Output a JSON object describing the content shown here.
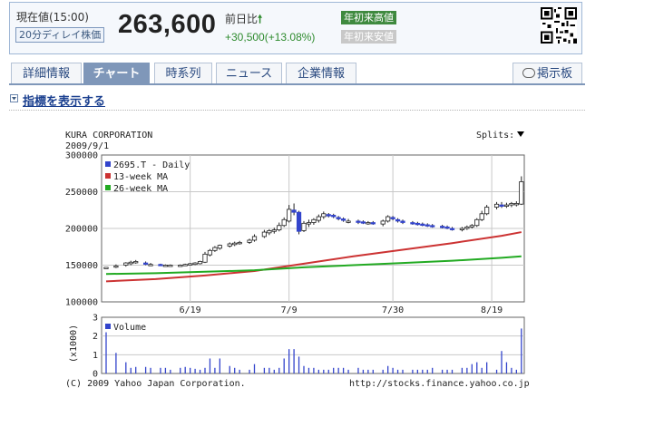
{
  "quote": {
    "price_label": "現在値(15:00)",
    "delay_label": "20分ディレイ株価",
    "price": "263,600",
    "change_label": "前日比",
    "change_value": "+30,500(+13.08%)",
    "ytd_high_label": "年初来高値",
    "ytd_low_label": "年初来安値"
  },
  "tabs": [
    {
      "label": "詳細情報",
      "active": false
    },
    {
      "label": "チャート",
      "active": true
    },
    {
      "label": "時系列",
      "active": false
    },
    {
      "label": "ニュース",
      "active": false
    },
    {
      "label": "企業情報",
      "active": false
    }
  ],
  "board_label": "掲示板",
  "indicator_toggle": "指標を表示する",
  "chart_header": {
    "company": "KURA CORPORATION",
    "date": "2009/9/1",
    "splits_label": "Splits:"
  },
  "footer": {
    "copyright": "(C) 2009 Yahoo Japan Corporation.",
    "url": "http://stocks.finance.yahoo.co.jp"
  },
  "chart_data": [
    {
      "type": "candlestick",
      "ylim": [
        100000,
        300000
      ],
      "y_ticks": [
        "300000",
        "250000",
        "200000",
        "150000",
        "100000"
      ],
      "x_ticks": [
        {
          "label": "6/19",
          "day": 17
        },
        {
          "label": "7/9",
          "day": 37
        },
        {
          "label": "7/30",
          "day": 58
        },
        {
          "label": "8/19",
          "day": 78
        }
      ],
      "legend": [
        {
          "name": "2695.T - Daily",
          "color": "#3344cc"
        },
        {
          "name": "13-week MA",
          "color": "#cc3333"
        },
        {
          "name": "26-week MA",
          "color": "#22aa22"
        }
      ],
      "candles": [
        [
          0,
          147000,
          147000,
          145000,
          147000
        ],
        [
          2,
          148000,
          151000,
          146000,
          149000
        ],
        [
          4,
          150000,
          154000,
          148000,
          153000
        ],
        [
          5,
          152000,
          156000,
          150000,
          154000
        ],
        [
          6,
          154000,
          157000,
          152000,
          155000
        ],
        [
          8,
          153000,
          155000,
          150000,
          152000
        ],
        [
          9,
          151000,
          153000,
          149000,
          151000
        ],
        [
          11,
          151000,
          152000,
          149000,
          150000
        ],
        [
          12,
          150000,
          151000,
          148000,
          150000
        ],
        [
          13,
          150000,
          151000,
          149000,
          150000
        ],
        [
          15,
          150000,
          151000,
          149000,
          150000
        ],
        [
          16,
          150000,
          152000,
          149000,
          151000
        ],
        [
          17,
          151000,
          153000,
          150000,
          152000
        ],
        [
          18,
          151000,
          154000,
          150000,
          153000
        ],
        [
          19,
          152000,
          156000,
          151000,
          155000
        ],
        [
          20,
          154000,
          168000,
          153000,
          165000
        ],
        [
          21,
          164000,
          172000,
          162000,
          170000
        ],
        [
          22,
          170000,
          176000,
          168000,
          174000
        ],
        [
          23,
          173000,
          178000,
          171000,
          177000
        ],
        [
          25,
          176000,
          181000,
          174000,
          179000
        ],
        [
          26,
          178000,
          182000,
          176000,
          180000
        ],
        [
          27,
          180000,
          183000,
          178000,
          181000
        ],
        [
          29,
          181000,
          186000,
          179000,
          184000
        ],
        [
          30,
          184000,
          192000,
          182000,
          189000
        ],
        [
          32,
          189000,
          198000,
          187000,
          195000
        ],
        [
          33,
          194000,
          199000,
          191000,
          197000
        ],
        [
          34,
          196000,
          201000,
          193000,
          198000
        ],
        [
          35,
          198000,
          208000,
          196000,
          204000
        ],
        [
          36,
          204000,
          215000,
          202000,
          212000
        ],
        [
          37,
          210000,
          232000,
          208000,
          226000
        ],
        [
          38,
          225000,
          234000,
          218000,
          222000
        ],
        [
          39,
          222000,
          224000,
          192000,
          196000
        ],
        [
          40,
          197000,
          210000,
          195000,
          207000
        ],
        [
          41,
          206000,
          212000,
          202000,
          208000
        ],
        [
          42,
          208000,
          214000,
          205000,
          212000
        ],
        [
          43,
          211000,
          219000,
          208000,
          216000
        ],
        [
          44,
          216000,
          223000,
          213000,
          220000
        ],
        [
          45,
          219000,
          221000,
          215000,
          217000
        ],
        [
          46,
          218000,
          220000,
          214000,
          216000
        ],
        [
          47,
          215000,
          217000,
          211000,
          213000
        ],
        [
          48,
          213000,
          215000,
          209000,
          211000
        ],
        [
          49,
          210000,
          213000,
          207000,
          210000
        ],
        [
          51,
          210000,
          212000,
          206000,
          209000
        ],
        [
          52,
          209000,
          211000,
          206000,
          208000
        ],
        [
          53,
          208000,
          210000,
          205000,
          208000
        ],
        [
          54,
          208000,
          210000,
          205000,
          207000
        ],
        [
          56,
          206000,
          212000,
          203000,
          210000
        ],
        [
          57,
          210000,
          218000,
          208000,
          216000
        ],
        [
          58,
          215000,
          217000,
          211000,
          213000
        ],
        [
          59,
          212000,
          214000,
          208000,
          210000
        ],
        [
          60,
          210000,
          212000,
          206000,
          208000
        ],
        [
          62,
          208000,
          210000,
          205000,
          207000
        ],
        [
          63,
          207000,
          209000,
          204000,
          206000
        ],
        [
          64,
          206000,
          208000,
          203000,
          205000
        ],
        [
          65,
          205000,
          207000,
          202000,
          204000
        ],
        [
          66,
          204000,
          206000,
          201000,
          203000
        ],
        [
          68,
          203000,
          205000,
          200000,
          202000
        ],
        [
          69,
          202000,
          204000,
          199000,
          201000
        ],
        [
          70,
          200000,
          202000,
          197000,
          199000
        ],
        [
          72,
          199000,
          202000,
          196000,
          200000
        ],
        [
          73,
          200000,
          204000,
          198000,
          202000
        ],
        [
          74,
          202000,
          206000,
          200000,
          204000
        ],
        [
          75,
          204000,
          214000,
          202000,
          212000
        ],
        [
          76,
          212000,
          224000,
          210000,
          220000
        ],
        [
          77,
          220000,
          232000,
          218000,
          229000
        ],
        [
          79,
          229000,
          236000,
          226000,
          233000
        ],
        [
          80,
          232000,
          236000,
          228000,
          231000
        ],
        [
          81,
          231000,
          235000,
          228000,
          232000
        ],
        [
          82,
          232000,
          236000,
          229000,
          234000
        ],
        [
          83,
          233000,
          237000,
          230000,
          234000
        ],
        [
          84,
          233100,
          271000,
          232000,
          263600
        ]
      ],
      "ma13": [
        [
          0,
          128000
        ],
        [
          10,
          131000
        ],
        [
          20,
          136000
        ],
        [
          30,
          142000
        ],
        [
          40,
          152000
        ],
        [
          50,
          162000
        ],
        [
          60,
          171000
        ],
        [
          70,
          180000
        ],
        [
          80,
          190000
        ],
        [
          84,
          195000
        ]
      ],
      "ma26": [
        [
          0,
          138000
        ],
        [
          10,
          139000
        ],
        [
          20,
          141000
        ],
        [
          30,
          143000
        ],
        [
          40,
          147000
        ],
        [
          50,
          150000
        ],
        [
          60,
          153000
        ],
        [
          70,
          156000
        ],
        [
          80,
          160000
        ],
        [
          84,
          162000
        ]
      ]
    },
    {
      "type": "bar",
      "title": "Volume",
      "ylabel": "(x1000)",
      "ylim": [
        0,
        3
      ],
      "y_ticks": [
        "3",
        "2",
        "1",
        "0"
      ],
      "days": [
        0,
        2,
        4,
        5,
        6,
        8,
        9,
        11,
        12,
        13,
        15,
        16,
        17,
        18,
        19,
        20,
        21,
        22,
        23,
        25,
        26,
        27,
        29,
        30,
        32,
        33,
        34,
        35,
        36,
        37,
        38,
        39,
        40,
        41,
        42,
        43,
        44,
        45,
        46,
        47,
        48,
        49,
        51,
        52,
        53,
        54,
        56,
        57,
        58,
        59,
        60,
        62,
        63,
        64,
        65,
        66,
        68,
        69,
        70,
        72,
        73,
        74,
        75,
        76,
        77,
        79,
        80,
        81,
        82,
        83,
        84
      ],
      "values": [
        2.2,
        1.1,
        0.6,
        0.3,
        0.35,
        0.35,
        0.3,
        0.3,
        0.3,
        0.2,
        0.3,
        0.35,
        0.3,
        0.25,
        0.2,
        0.3,
        0.8,
        0.3,
        0.8,
        0.4,
        0.3,
        0.2,
        0.2,
        0.5,
        0.3,
        0.3,
        0.2,
        0.3,
        0.8,
        1.3,
        1.3,
        0.9,
        0.4,
        0.3,
        0.3,
        0.2,
        0.2,
        0.2,
        0.3,
        0.3,
        0.3,
        0.2,
        0.3,
        0.2,
        0.2,
        0.2,
        0.2,
        0.4,
        0.3,
        0.2,
        0.2,
        0.2,
        0.2,
        0.2,
        0.2,
        0.3,
        0.2,
        0.2,
        0.2,
        0.3,
        0.3,
        0.5,
        0.6,
        0.3,
        0.6,
        0.2,
        1.2,
        0.6,
        0.3,
        0.2,
        2.4
      ]
    }
  ]
}
